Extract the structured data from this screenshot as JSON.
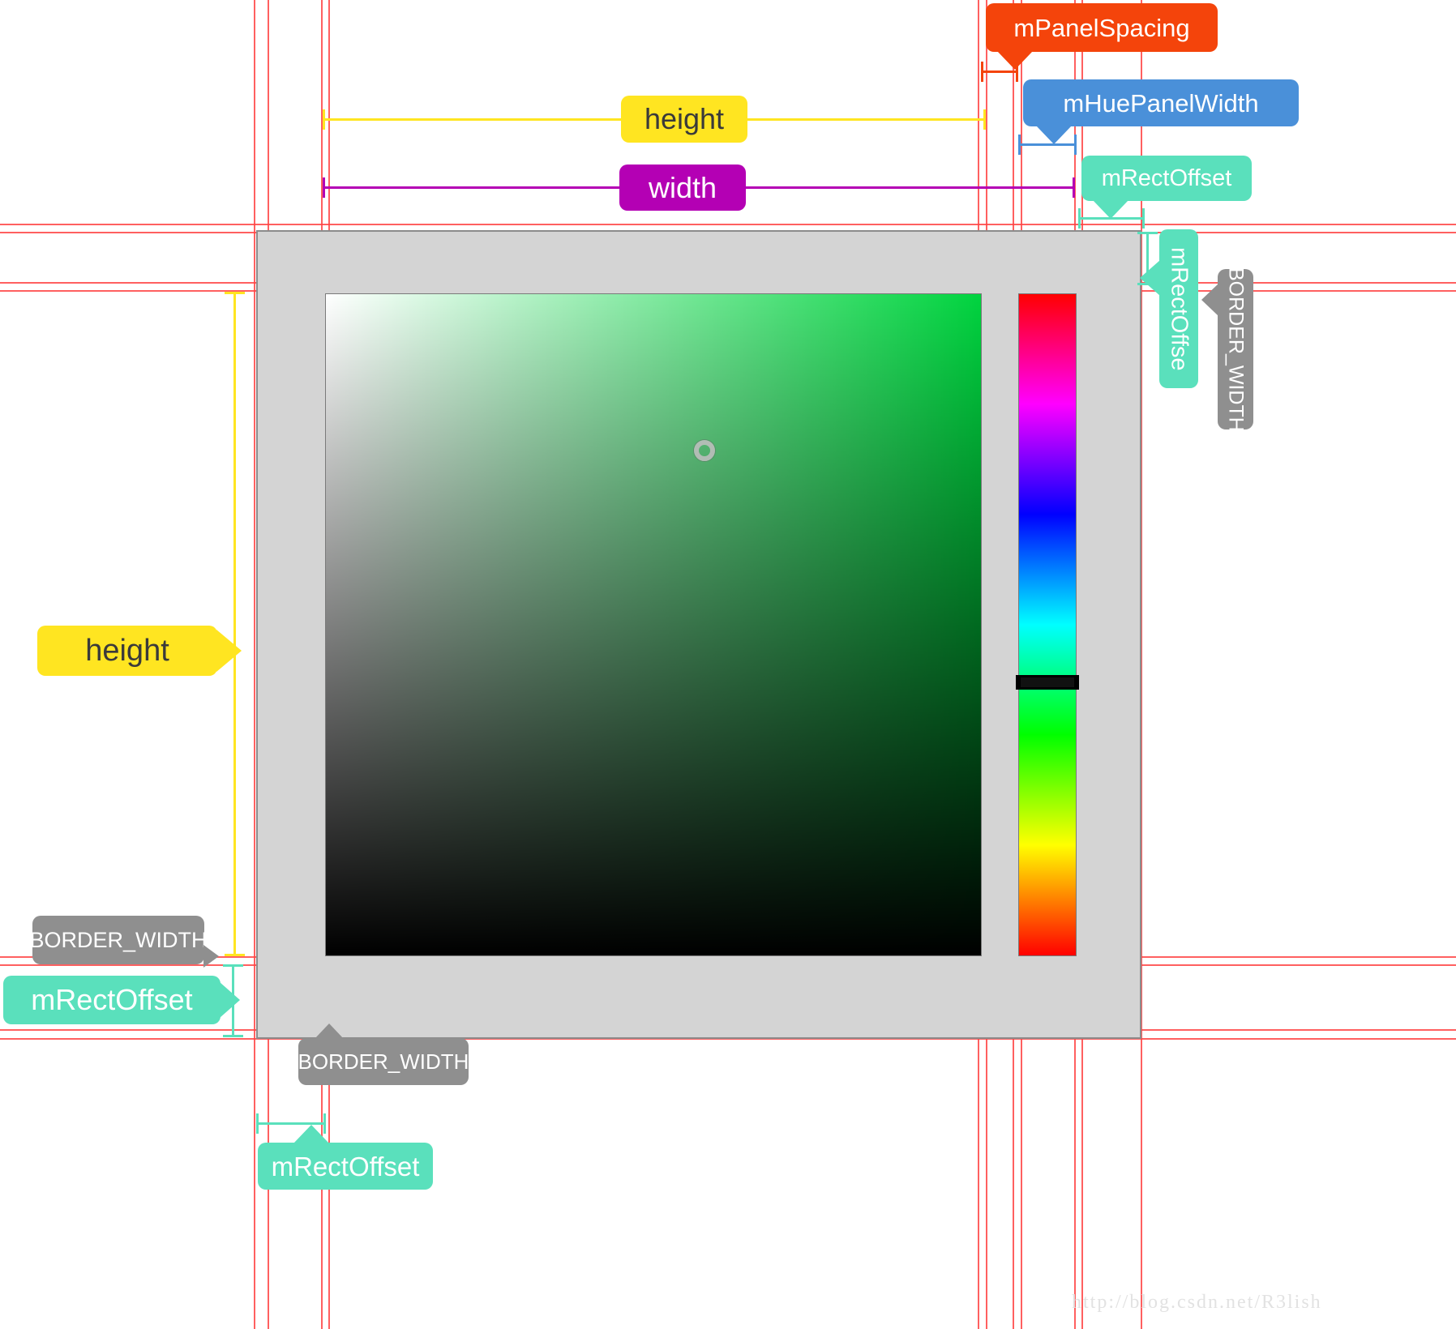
{
  "watermark": "http://blog.csdn.net/R3lish",
  "labels": {
    "panel_spacing": "mPanelSpacing",
    "hue_panel_width": "mHuePanelWidth",
    "rect_offset_top_right": "mRectOffset",
    "rect_offset_vertical_right": "mRectOffse",
    "border_width_vertical_right": "BORDER_WIDTH",
    "height_top": "height",
    "width_top": "width",
    "height_left": "height",
    "border_width_left": "BORDER_WIDTH",
    "rect_offset_left": "mRectOffset",
    "border_width_bottom": "BORDER_WIDTH",
    "rect_offset_bottom": "mRectOffset"
  },
  "colors": {
    "guide_line": "#ff4444",
    "panel_background": "#d4d4d4",
    "panel_border": "#8c8c8c",
    "callout_orange": "#f4440b",
    "callout_blue": "#4a90d9",
    "callout_green": "#5ae0bc",
    "callout_yellow": "#ffe521",
    "callout_purple": "#b400b4",
    "callout_gray": "#8f8f8f",
    "selected_hue": "#00d43f"
  },
  "widget": {
    "sat_val_panel_name": "saturation-value-panel",
    "hue_panel_name": "hue-panel",
    "sat_val_tracker_name": "sat-val-tracker",
    "hue_tracker_name": "hue-tracker"
  }
}
